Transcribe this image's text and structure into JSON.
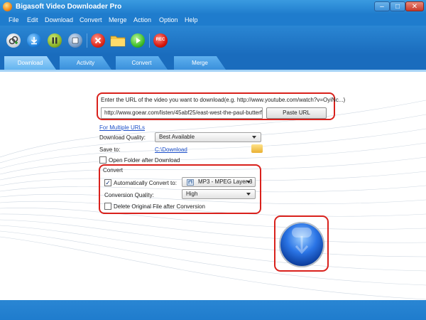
{
  "window": {
    "title": "Bigasoft Video Downloader Pro",
    "controls": {
      "minimize": "–",
      "maximize": "□",
      "close": "✕"
    }
  },
  "menu": [
    "File",
    "Edit",
    "Download",
    "Convert",
    "Merge",
    "Action",
    "Option",
    "Help"
  ],
  "toolbar": {
    "buttons": [
      {
        "name": "add-url",
        "icon": "link-plus-icon"
      },
      {
        "name": "download",
        "icon": "download-arrow-icon"
      },
      {
        "name": "pause",
        "icon": "pause-icon"
      },
      {
        "name": "stop",
        "icon": "stop-icon"
      },
      {
        "name": "delete",
        "icon": "x-mark-icon"
      },
      {
        "name": "open-folder",
        "icon": "folder-icon"
      },
      {
        "name": "play",
        "icon": "play-icon"
      },
      {
        "name": "record",
        "icon": "rec-icon",
        "label": "REC"
      }
    ]
  },
  "tabs": [
    {
      "label": "Download",
      "active": true
    },
    {
      "label": "Activity",
      "active": false
    },
    {
      "label": "Convert",
      "active": false
    },
    {
      "label": "Merge",
      "active": false
    }
  ],
  "download": {
    "url_prompt": "Enter the URL of the video you want to download(e.g. http://www.youtube.com/watch?v=OyiNc...)",
    "url_value": "http://www.goear.com/listen/45abf25/east-west-the-paul-butterfie",
    "paste_button": "Paste URL",
    "multiple_urls_link": "For Multiple URLs",
    "quality_label": "Download Quality:",
    "quality_value": "Best Available",
    "save_to_label": "Save to:",
    "save_to_path": "C:\\Download",
    "open_folder_label": "Open Folder after Download",
    "open_folder_checked": false
  },
  "convert": {
    "section_title": "Convert",
    "auto_convert_label": "Automatically Convert to:",
    "auto_convert_checked": true,
    "format_value": "MP3 - MPEG Layer-3 ...",
    "quality_label": "Conversion Quality:",
    "quality_value": "High",
    "delete_original_label": "Delete Original File after Conversion",
    "delete_original_checked": false
  },
  "colors": {
    "accent_blue": "#1f7ccd",
    "highlight_red": "#d9211c",
    "link_blue": "#1c4fc9"
  }
}
